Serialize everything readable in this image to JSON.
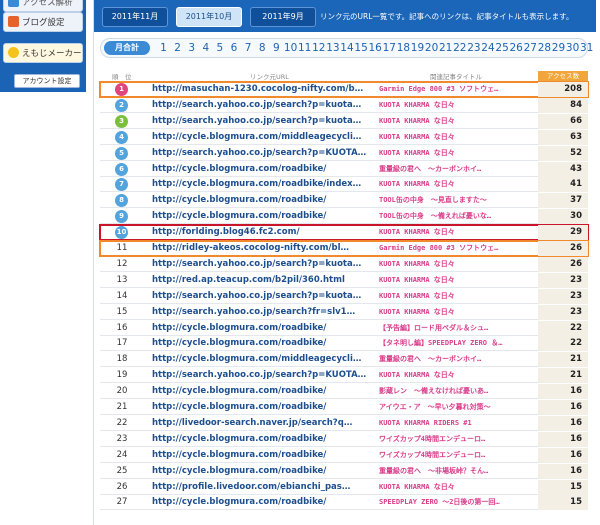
{
  "sidebar": {
    "top_label": "アクセス解析",
    "blog_settings": "ブログ設定",
    "emoji_maker": "えもじメーカー",
    "account_settings": "アカウント設定"
  },
  "header": {
    "month_tabs": [
      "2011年11月",
      "2011年10月",
      "2011年9月"
    ],
    "note": "リンク元のURL一覧です。記事へのリンクは、記事タイトルも表示します。"
  },
  "day_bar": {
    "label": "月合計",
    "days": [
      "1",
      "2",
      "3",
      "4",
      "5",
      "6",
      "7",
      "8",
      "9",
      "10",
      "11",
      "12",
      "13",
      "14",
      "15",
      "16",
      "17",
      "18",
      "19",
      "20",
      "21",
      "22",
      "23",
      "24",
      "25",
      "26",
      "27",
      "28",
      "29",
      "30",
      "31"
    ]
  },
  "table": {
    "headers": {
      "rank": "順　位",
      "url": "リンク元URL",
      "title": "関連記事タイトル",
      "count": "アクセス数"
    },
    "rows": [
      {
        "rank": "1",
        "url": "http://masuchan-1230.cocolog-nifty.com/b…",
        "title": "Garmin Edge 800 #3 ソフトウェ…",
        "count": "208"
      },
      {
        "rank": "2",
        "url": "http://search.yahoo.co.jp/search?p=kuota…",
        "title": "KUOTA KHARMA な日々",
        "count": "84"
      },
      {
        "rank": "3",
        "url": "http://search.yahoo.co.jp/search?p=kuota…",
        "title": "KUOTA KHARMA な日々",
        "count": "66"
      },
      {
        "rank": "4",
        "url": "http://cycle.blogmura.com/middleagecycli…",
        "title": "KUOTA KHARMA な日々",
        "count": "63"
      },
      {
        "rank": "5",
        "url": "http://search.yahoo.co.jp/search?p=KUOTA…",
        "title": "KUOTA KHARMA な日々",
        "count": "52"
      },
      {
        "rank": "6",
        "url": "http://cycle.blogmura.com/roadbike/",
        "title": "重量級の君へ　～カーボンホイ…",
        "count": "43"
      },
      {
        "rank": "7",
        "url": "http://cycle.blogmura.com/roadbike/index…",
        "title": "KUOTA KHARMA な日々",
        "count": "41"
      },
      {
        "rank": "8",
        "url": "http://cycle.blogmura.com/roadbike/",
        "title": "TOOL缶の中身　～見直しますた～",
        "count": "37"
      },
      {
        "rank": "9",
        "url": "http://cycle.blogmura.com/roadbike/",
        "title": "TOOL缶の中身　～備えれば憂いな…",
        "count": "30"
      },
      {
        "rank": "10",
        "url": "http://forlding.blog46.fc2.com/",
        "title": "KUOTA KHARMA な日々",
        "count": "29"
      },
      {
        "rank": "11",
        "url": "http://ridley-akeos.cocolog-nifty.com/bl…",
        "title": "Garmin Edge 800 #3 ソフトウェ…",
        "count": "26"
      },
      {
        "rank": "12",
        "url": "http://search.yahoo.co.jp/search?p=kuota…",
        "title": "KUOTA KHARMA な日々",
        "count": "26"
      },
      {
        "rank": "13",
        "url": "http://red.ap.teacup.com/b2pil/360.html",
        "title": "KUOTA KHARMA な日々",
        "count": "23"
      },
      {
        "rank": "14",
        "url": "http://search.yahoo.co.jp/search?p=kuota…",
        "title": "KUOTA KHARMA な日々",
        "count": "23"
      },
      {
        "rank": "15",
        "url": "http://search.yahoo.co.jp/search?fr=slv1…",
        "title": "KUOTA KHARMA な日々",
        "count": "23"
      },
      {
        "rank": "16",
        "url": "http://cycle.blogmura.com/roadbike/",
        "title": "【予告編】ロード用ペダル＆シュ…",
        "count": "22"
      },
      {
        "rank": "17",
        "url": "http://cycle.blogmura.com/roadbike/",
        "title": "【タネ明し編】SPEEDPLAY ZERO ＆…",
        "count": "22"
      },
      {
        "rank": "18",
        "url": "http://cycle.blogmura.com/middleagecycli…",
        "title": "重量級の君へ　～カーボンホイ…",
        "count": "21"
      },
      {
        "rank": "19",
        "url": "http://search.yahoo.co.jp/search?p=KUOTA…",
        "title": "KUOTA KHARMA な日々",
        "count": "21"
      },
      {
        "rank": "20",
        "url": "http://cycle.blogmura.com/roadbike/",
        "title": "影蔵レン　～備えなければ憂いあ…",
        "count": "16"
      },
      {
        "rank": "21",
        "url": "http://cycle.blogmura.com/roadbike/",
        "title": "アイウエ・ア　～早い夕暮れ対策～",
        "count": "16"
      },
      {
        "rank": "22",
        "url": "http://livedoor-search.naver.jp/search?q…",
        "title": "KUOTA KHARMA RIDERS #1",
        "count": "16"
      },
      {
        "rank": "23",
        "url": "http://cycle.blogmura.com/roadbike/",
        "title": "ワイズカップ4時間エンデューロ…",
        "count": "16"
      },
      {
        "rank": "24",
        "url": "http://cycle.blogmura.com/roadbike/",
        "title": "ワイズカップ4時間エンデューロ…",
        "count": "16"
      },
      {
        "rank": "25",
        "url": "http://cycle.blogmura.com/roadbike/",
        "title": "重量級の君へ　～非場坂峠？そん…",
        "count": "16"
      },
      {
        "rank": "26",
        "url": "http://profile.livedoor.com/ebianchi_pas…",
        "title": "KUOTA KHARMA な日々",
        "count": "15"
      },
      {
        "rank": "27",
        "url": "http://cycle.blogmura.com/roadbike/",
        "title": "SPEEDPLAY ZERO ～2日後の第一回…",
        "count": "15"
      }
    ]
  },
  "colors": {
    "header_blue": "#1b66b8",
    "title_pink": "#d83c8a",
    "url_blue": "#1d4f8f",
    "highlight_orange": "#f08a2d",
    "highlight_red": "#c8152a"
  }
}
